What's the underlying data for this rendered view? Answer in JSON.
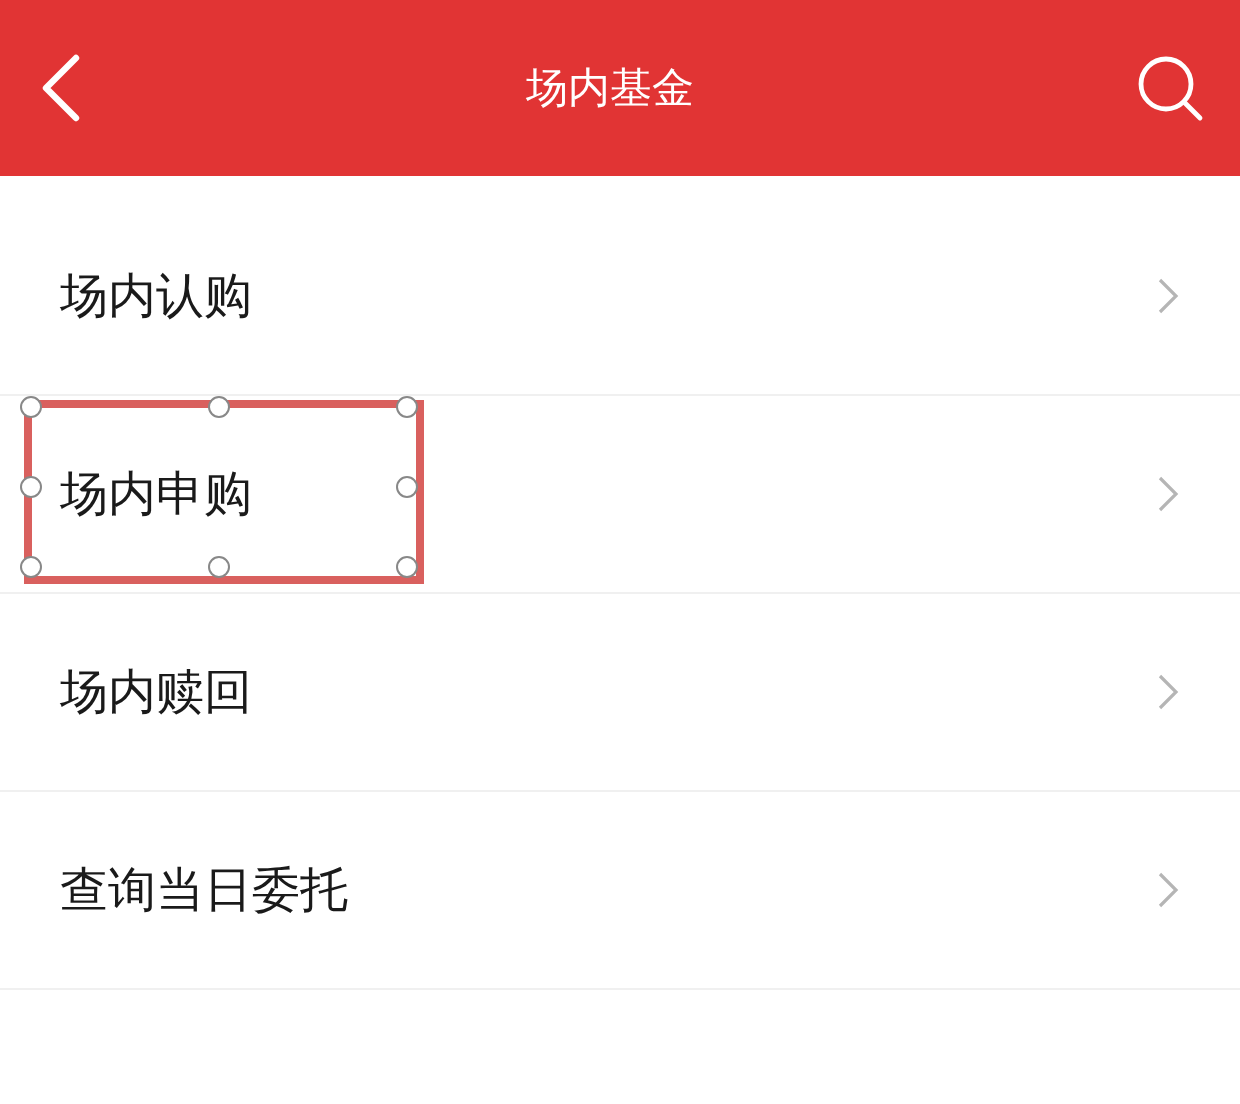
{
  "header": {
    "title": "场内基金"
  },
  "items": [
    {
      "label": "场内认购",
      "highlighted": false
    },
    {
      "label": "场内申购",
      "highlighted": true
    },
    {
      "label": "场内赎回",
      "highlighted": false
    },
    {
      "label": "查询当日委托",
      "highlighted": false
    }
  ]
}
